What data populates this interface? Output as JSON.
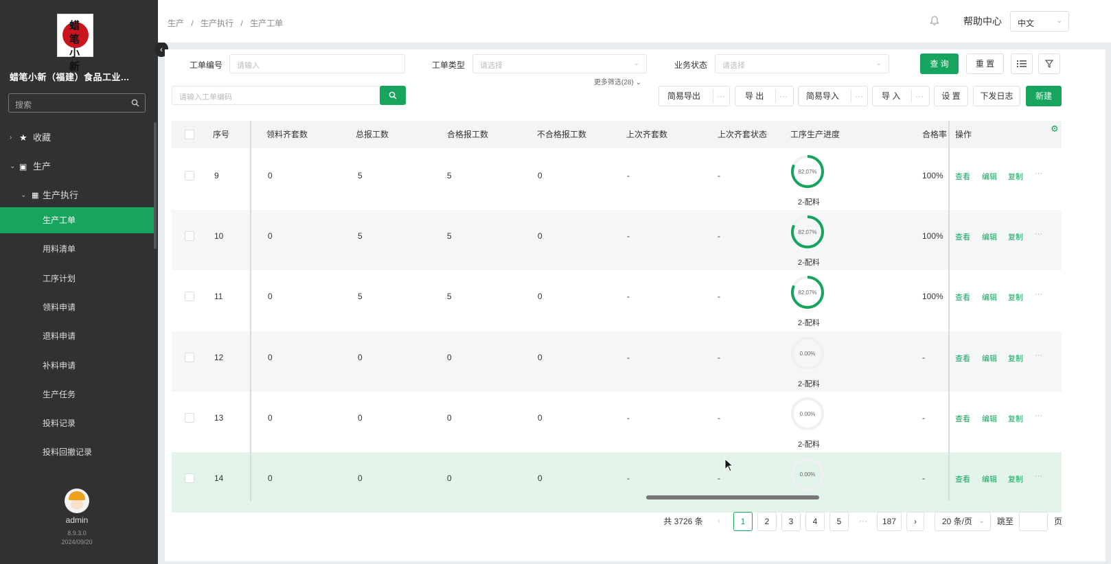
{
  "sidebar": {
    "logo_text": "蜡笔小新",
    "company": "蜡笔小新（福建）食品工业...",
    "search_placeholder": "搜索",
    "collapse_glyph": "‹",
    "menu": {
      "favorites": "收藏",
      "production": "生产",
      "production_exec": "生产执行",
      "items": [
        "生产工单",
        "用料清单",
        "工序计划",
        "领料申请",
        "退料申请",
        "补料申请",
        "生产任务",
        "投料记录",
        "投料回撤记录"
      ],
      "active_index": 0
    },
    "user": {
      "name": "admin",
      "version": "8.9.3.0",
      "date": "2024/09/20"
    }
  },
  "header": {
    "breadcrumb": [
      "生产",
      "/",
      "生产执行",
      "/",
      "生产工单"
    ],
    "help": "帮助中心",
    "language": "中文"
  },
  "filters": {
    "order_no_label": "工单编号",
    "order_no_placeholder": "请输入",
    "order_type_label": "工单类型",
    "order_type_placeholder": "请选择",
    "biz_status_label": "业务状态",
    "biz_status_placeholder": "请选择",
    "more_filters": "更多筛选(28)",
    "query": "查 询",
    "reset": "重 置"
  },
  "toolbar": {
    "search_placeholder": "请输入工单编码",
    "easy_export": "简易导出",
    "export": "导 出",
    "easy_import": "简易导入",
    "import": "导 入",
    "settings": "设 置",
    "issue_log": "下发日志",
    "create": "新建",
    "dots": "···"
  },
  "table": {
    "columns": [
      "序号",
      "领料齐套数",
      "总报工数",
      "合格报工数",
      "不合格报工数",
      "上次齐套数",
      "上次齐套状态",
      "工序生产进度",
      "合格率",
      "操作"
    ],
    "actions": {
      "view": "查看",
      "edit": "编辑",
      "copy": "复制",
      "more": "···"
    },
    "rows": [
      {
        "seq": "9",
        "kit": "0",
        "total": "5",
        "qualified": "5",
        "unqualified": "0",
        "last_kit": "-",
        "last_status": "-",
        "progress_text": "82.07%",
        "progress": 0.8207,
        "step": "2-配料",
        "pass_rate": "100%"
      },
      {
        "seq": "10",
        "kit": "0",
        "total": "5",
        "qualified": "5",
        "unqualified": "0",
        "last_kit": "-",
        "last_status": "-",
        "progress_text": "82.07%",
        "progress": 0.8207,
        "step": "2-配料",
        "pass_rate": "100%"
      },
      {
        "seq": "11",
        "kit": "0",
        "total": "5",
        "qualified": "5",
        "unqualified": "0",
        "last_kit": "-",
        "last_status": "-",
        "progress_text": "82.07%",
        "progress": 0.8207,
        "step": "2-配料",
        "pass_rate": "100%"
      },
      {
        "seq": "12",
        "kit": "0",
        "total": "0",
        "qualified": "0",
        "unqualified": "0",
        "last_kit": "-",
        "last_status": "-",
        "progress_text": "0.00%",
        "progress": 0,
        "step": "2-配料",
        "pass_rate": "-"
      },
      {
        "seq": "13",
        "kit": "0",
        "total": "0",
        "qualified": "0",
        "unqualified": "0",
        "last_kit": "-",
        "last_status": "-",
        "progress_text": "0.00%",
        "progress": 0,
        "step": "2-配料",
        "pass_rate": "-"
      },
      {
        "seq": "14",
        "kit": "0",
        "total": "0",
        "qualified": "0",
        "unqualified": "0",
        "last_kit": "-",
        "last_status": "-",
        "progress_text": "0.00%",
        "progress": 0,
        "step": "",
        "pass_rate": "-"
      }
    ]
  },
  "pagination": {
    "total": "共 3726 条",
    "pages": [
      "1",
      "2",
      "3",
      "4",
      "5"
    ],
    "ellipsis": "···",
    "last": "187",
    "current": "1",
    "page_size": "20 条/页",
    "goto": "跳至",
    "page_unit": "页",
    "prev": "‹",
    "next": "›"
  },
  "colors": {
    "accent": "#16a45e",
    "sidebar": "#2f3133"
  }
}
